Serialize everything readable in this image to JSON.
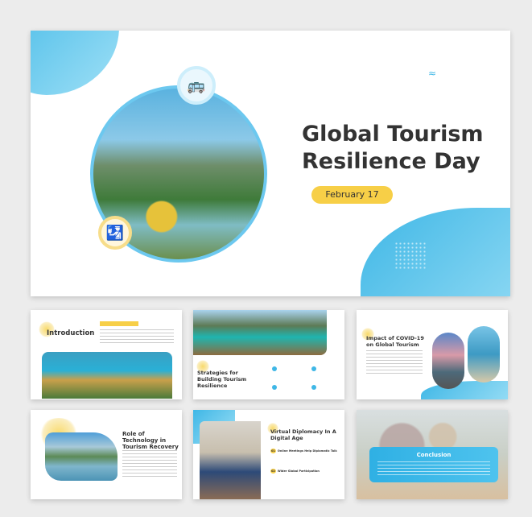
{
  "main_slide": {
    "title_line1": "Global Tourism",
    "title_line2": "Resilience Day",
    "date": "February 17",
    "icons": [
      "bus-icon",
      "passport-icon"
    ]
  },
  "thumbnails": [
    {
      "title": "Introduction"
    },
    {
      "title": "Strategies for Building Tourism Resilience"
    },
    {
      "title": "Impact of COVID-19 on Global Tourism"
    },
    {
      "title": "Role of Technology in Tourism Recovery"
    },
    {
      "title": "Virtual Diplomacy In A Digital Age",
      "points": [
        "Online Meetings Help Diplomatic Talk",
        "Wider Global Participation"
      ],
      "numbers": [
        "01",
        "02"
      ]
    },
    {
      "title": "Conclusion"
    }
  ],
  "colors": {
    "accent_blue": "#3fb7e6",
    "accent_yellow": "#f7cf47",
    "text": "#333333",
    "background": "#ececec"
  }
}
